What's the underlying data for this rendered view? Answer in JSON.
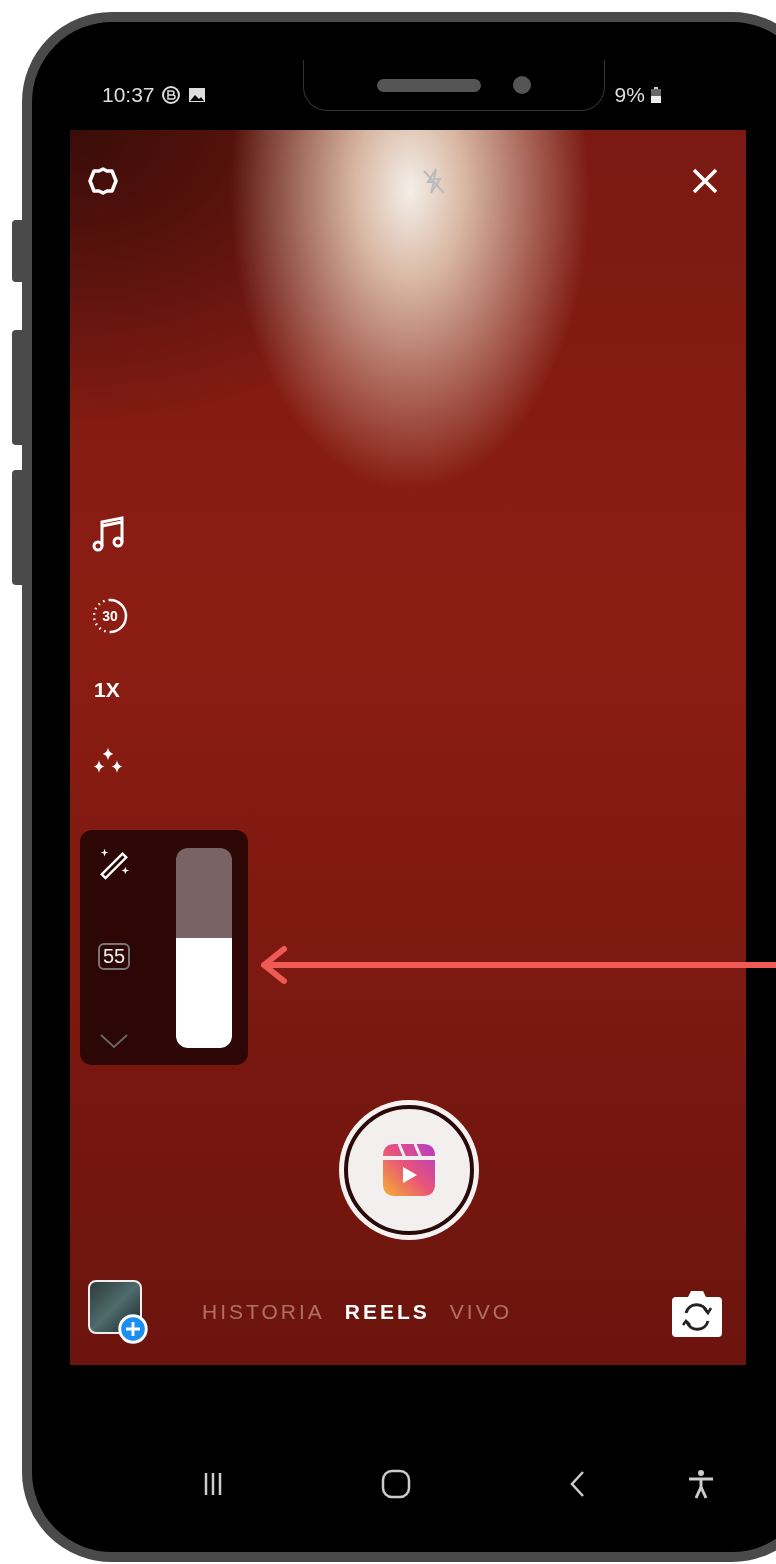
{
  "status_bar": {
    "time": "10:37",
    "battery": "9%"
  },
  "side_tools": {
    "timer": "30",
    "speed": "1X"
  },
  "touch_up": {
    "value": "55",
    "level": 0.55
  },
  "mode_tabs": [
    {
      "label": "HISTORIA",
      "selected": false
    },
    {
      "label": "REELS",
      "selected": true
    },
    {
      "label": "VIVO",
      "selected": false
    }
  ]
}
